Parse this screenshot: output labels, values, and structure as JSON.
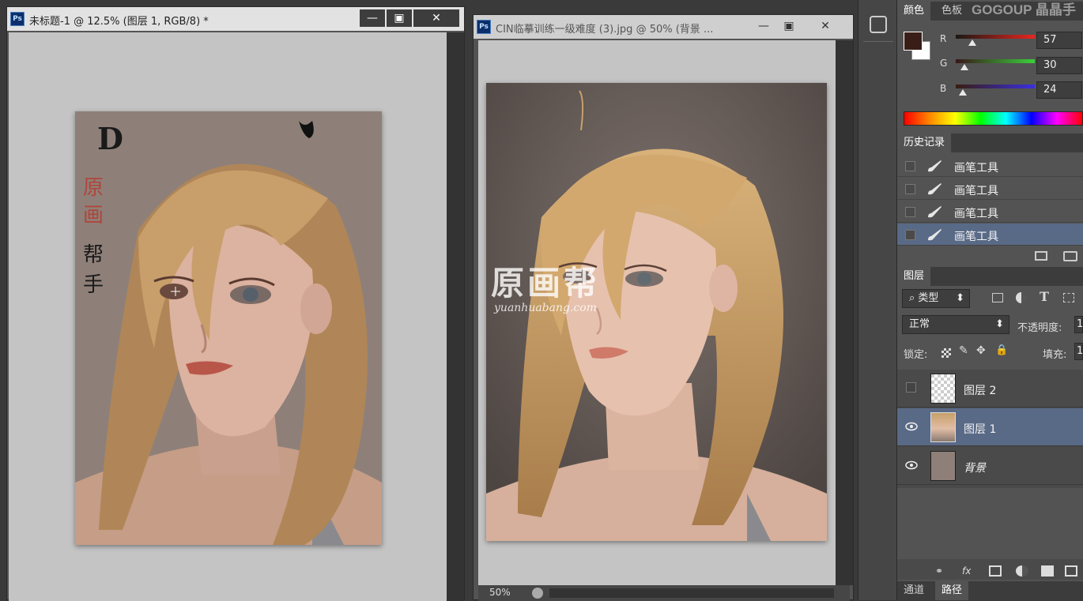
{
  "doc1": {
    "title": "未标题-1 @ 12.5% (图层 1, RGB/8) *",
    "ps_badge": "Ps",
    "calligraphy": [
      "D",
      "原",
      "画",
      "帮",
      "手"
    ]
  },
  "doc2": {
    "title": "CIN临摹训练一级难度 (3).jpg @ 50% (背景 ...",
    "ps_badge": "Ps",
    "zoom": "50%"
  },
  "watermark": {
    "line1": "原画帮",
    "line2": "yuanhuabang.com"
  },
  "top_right_text": "GOGOUP 晶晶手",
  "window_controls": {
    "minimize": "—",
    "maximize": "▣",
    "close": "✕"
  },
  "color_panel": {
    "tabs": [
      "颜色",
      "色板"
    ],
    "foreground": "#391e18",
    "background": "#ffffff",
    "channels": [
      {
        "label": "R",
        "value": "57"
      },
      {
        "label": "G",
        "value": "30"
      },
      {
        "label": "B",
        "value": "24"
      }
    ]
  },
  "history_panel": {
    "tab": "历史记录",
    "items": [
      {
        "label": "画笔工具",
        "selected": false
      },
      {
        "label": "画笔工具",
        "selected": false
      },
      {
        "label": "画笔工具",
        "selected": false
      },
      {
        "label": "画笔工具",
        "selected": true
      }
    ]
  },
  "layers_panel": {
    "tab": "图层",
    "filter": "类型",
    "blend_mode": "正常",
    "opacity_label": "不透明度:",
    "opacity_value": "1",
    "lock_label": "锁定:",
    "fill_label": "填充:",
    "fill_value": "1",
    "layers": [
      {
        "name": "图层 2",
        "visible": false,
        "selected": false
      },
      {
        "name": "图层 1",
        "visible": true,
        "selected": true
      },
      {
        "name": "背景",
        "visible": true,
        "selected": false
      }
    ]
  },
  "bottom_tabs": [
    "通道",
    "路径"
  ]
}
